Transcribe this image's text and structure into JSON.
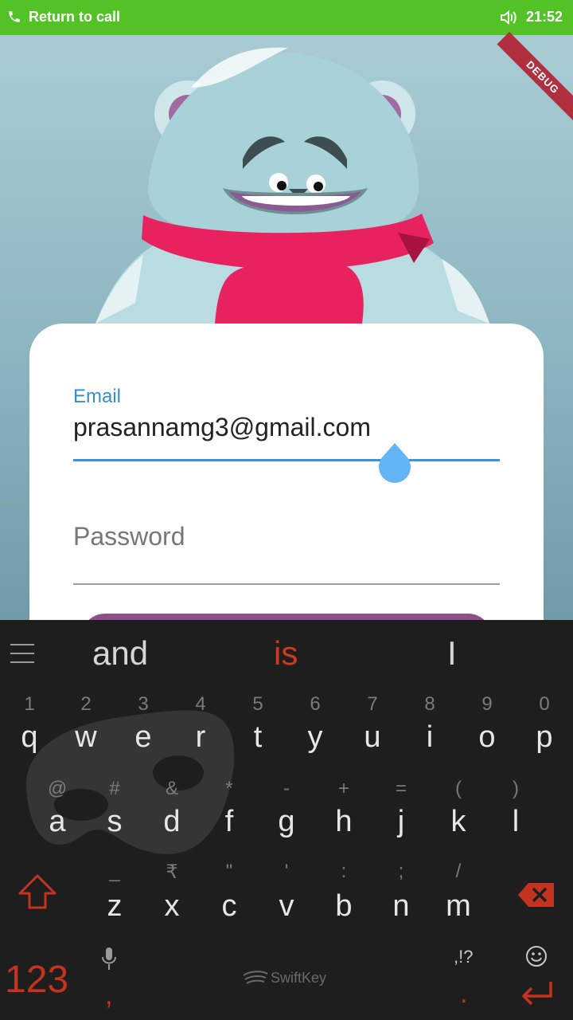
{
  "status_bar": {
    "call_text": "Return to call",
    "time": "21:52"
  },
  "debug_banner": "DEBUG",
  "login": {
    "email_label": "Email",
    "email_value": "prasannamg3@gmail.com",
    "password_placeholder": "Password"
  },
  "keyboard": {
    "suggestions": [
      "and",
      "is",
      "I"
    ],
    "row1": {
      "keys": [
        "q",
        "w",
        "e",
        "r",
        "t",
        "y",
        "u",
        "i",
        "o",
        "p"
      ],
      "hints": [
        "1",
        "2",
        "3",
        "4",
        "5",
        "6",
        "7",
        "8",
        "9",
        "0"
      ]
    },
    "row2": {
      "keys": [
        "a",
        "s",
        "d",
        "f",
        "g",
        "h",
        "j",
        "k",
        "l"
      ],
      "hints": [
        "@",
        "#",
        "&",
        "*",
        "-",
        "+",
        "=",
        "(",
        ")"
      ]
    },
    "row3": {
      "keys": [
        "z",
        "x",
        "c",
        "v",
        "b",
        "n",
        "m"
      ],
      "hints": [
        "_",
        "₹",
        "\"",
        "'",
        ":",
        ";",
        "/"
      ]
    },
    "numbers_key": "123",
    "comma_key": ",",
    "punctuation_key": ",!?",
    "period_key": ".",
    "brand": "SwiftKey"
  },
  "colors": {
    "accent": "#3a93d5",
    "status_green": "#52c226",
    "keyboard_accent": "#c4331f",
    "scarf": "#e8215f"
  }
}
